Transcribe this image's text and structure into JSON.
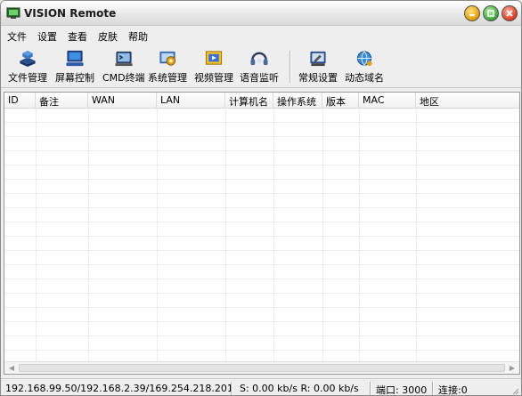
{
  "window": {
    "title": "VISION Remote"
  },
  "menu": [
    "文件",
    "设置",
    "查看",
    "皮肤",
    "帮助"
  ],
  "toolbar": [
    {
      "label": "文件管理",
      "icon": "file-manager-icon"
    },
    {
      "label": "屏幕控制",
      "icon": "screen-control-icon"
    },
    {
      "label": "CMD终端",
      "icon": "cmd-terminal-icon"
    },
    {
      "label": "系统管理",
      "icon": "system-manage-icon"
    },
    {
      "label": "视频管理",
      "icon": "video-manage-icon"
    },
    {
      "label": "语音监听",
      "icon": "voice-monitor-icon"
    },
    {
      "label": "常规设置",
      "icon": "general-settings-icon"
    },
    {
      "label": "动态域名",
      "icon": "dynamic-dns-icon"
    }
  ],
  "table": {
    "columns": [
      "ID",
      "备注",
      "WAN",
      "LAN",
      "计算机名",
      "操作系统",
      "版本",
      "MAC",
      "地区"
    ],
    "rows": []
  },
  "status": {
    "ips": "192.168.99.50/192.168.2.39/169.254.218.201",
    "speed": "S: 0.00 kb/s R: 0.00 kb/s",
    "port": "端口: 3000",
    "connections": "连接:0"
  },
  "colors": {
    "accent": "#1e6fd8",
    "window_bg": "#eeeeee"
  }
}
